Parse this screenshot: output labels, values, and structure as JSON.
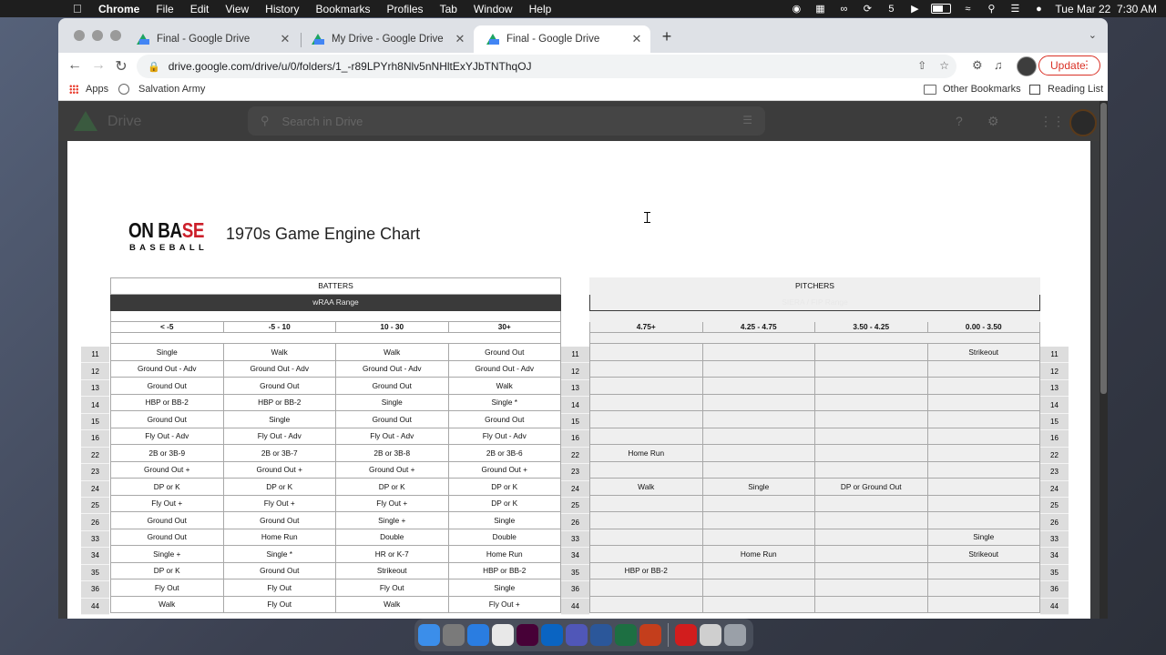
{
  "menubar": {
    "app_name": "Chrome",
    "menus": [
      "File",
      "Edit",
      "View",
      "History",
      "Bookmarks",
      "Profiles",
      "Tab",
      "Window",
      "Help"
    ],
    "datetime": "Tue Mar 22  7:30 AM"
  },
  "tabs": [
    {
      "label": "Final - Google Drive",
      "active": false
    },
    {
      "label": "My Drive - Google Drive",
      "active": false
    },
    {
      "label": "Final - Google Drive",
      "active": true
    }
  ],
  "toolbar": {
    "url": "drive.google.com/drive/u/0/folders/1_-r89LPYrh8Nlv5nNHltExYJbTNThqOJ",
    "update_label": "Update"
  },
  "bookmarks": {
    "apps_label": "Apps",
    "items": [
      "Salvation Army"
    ],
    "other_label": "Other Bookmarks",
    "reading_list_label": "Reading List"
  },
  "drive": {
    "logo_text": "Drive",
    "search_placeholder": "Search in Drive"
  },
  "doc": {
    "logo_main_dark": "ON BA",
    "logo_main_red": "SE",
    "logo_sub": "BASEBALL",
    "title": "1970s Game Engine Chart",
    "batters": {
      "heading": "BATTERS",
      "range_label": "wRAA Range",
      "columns": [
        "< -5",
        "-5 - 10",
        "10 - 30",
        "30+"
      ],
      "rows": [
        [
          "Single",
          "Walk",
          "Walk",
          "Ground Out"
        ],
        [
          "Ground Out - Adv",
          "Ground Out - Adv",
          "Ground Out - Adv",
          "Ground Out - Adv"
        ],
        [
          "Ground Out",
          "Ground Out",
          "Ground Out",
          "Walk"
        ],
        [
          "HBP or BB-2",
          "HBP or BB-2",
          "Single",
          "Single *"
        ],
        [
          "Ground Out",
          "Single",
          "Ground Out",
          "Ground Out"
        ],
        [
          "Fly Out - Adv",
          "Fly Out - Adv",
          "Fly Out - Adv",
          "Fly Out - Adv"
        ],
        [
          "2B or 3B-9",
          "2B or 3B-7",
          "2B or 3B-8",
          "2B or 3B-6"
        ],
        [
          "Ground Out +",
          "Ground Out +",
          "Ground Out +",
          "Ground Out +"
        ],
        [
          "DP or K",
          "DP or K",
          "DP or K",
          "DP or K"
        ],
        [
          "Fly Out +",
          "Fly Out +",
          "Fly Out +",
          "DP or K"
        ],
        [
          "Ground Out",
          "Ground Out",
          "Single +",
          "Single"
        ],
        [
          "Ground Out",
          "Home Run",
          "Double",
          "Double"
        ],
        [
          "Single +",
          "Single *",
          "HR or K-7",
          "Home Run"
        ],
        [
          "DP or K",
          "Ground Out",
          "Strikeout",
          "HBP or BB-2"
        ],
        [
          "Fly Out",
          "Fly Out",
          "Fly Out",
          "Single"
        ],
        [
          "Walk",
          "Fly Out",
          "Walk",
          "Fly Out +"
        ]
      ]
    },
    "pitchers": {
      "heading": "PITCHERS",
      "range_label": "SIERA / FIP Range",
      "columns": [
        "4.75+",
        "4.25 - 4.75",
        "3.50 - 4.25",
        "0.00 - 3.50"
      ],
      "rows": [
        [
          "",
          "",
          "",
          "Strikeout"
        ],
        [
          "",
          "",
          "",
          ""
        ],
        [
          "",
          "",
          "",
          ""
        ],
        [
          "",
          "",
          "",
          ""
        ],
        [
          "",
          "",
          "",
          ""
        ],
        [
          "",
          "",
          "",
          ""
        ],
        [
          "Home Run",
          "",
          "",
          ""
        ],
        [
          "",
          "",
          "",
          ""
        ],
        [
          "Walk",
          "Single",
          "DP or Ground Out",
          ""
        ],
        [
          "",
          "",
          "",
          ""
        ],
        [
          "",
          "",
          "",
          ""
        ],
        [
          "",
          "",
          "",
          "Single"
        ],
        [
          "",
          "Home Run",
          "",
          "Strikeout"
        ],
        [
          "HBP or BB-2",
          "",
          "",
          ""
        ],
        [
          "",
          "",
          "",
          ""
        ],
        [
          "",
          "",
          "",
          ""
        ]
      ]
    },
    "roll_numbers": [
      "11",
      "12",
      "13",
      "14",
      "15",
      "16",
      "22",
      "23",
      "24",
      "25",
      "26",
      "33",
      "34",
      "35",
      "36",
      "44"
    ]
  },
  "dock": {
    "apps": [
      "Finder",
      "System Preferences",
      "Safari",
      "Chrome",
      "Adobe XD",
      "Outlook",
      "Teams",
      "Word",
      "Excel",
      "PowerPoint",
      "Acrobat",
      "Preview",
      "Trash"
    ]
  },
  "colors": {
    "update_red": "#d93025",
    "logo_red": "#cc1f2a",
    "header_dark": "#3a3a3a"
  }
}
